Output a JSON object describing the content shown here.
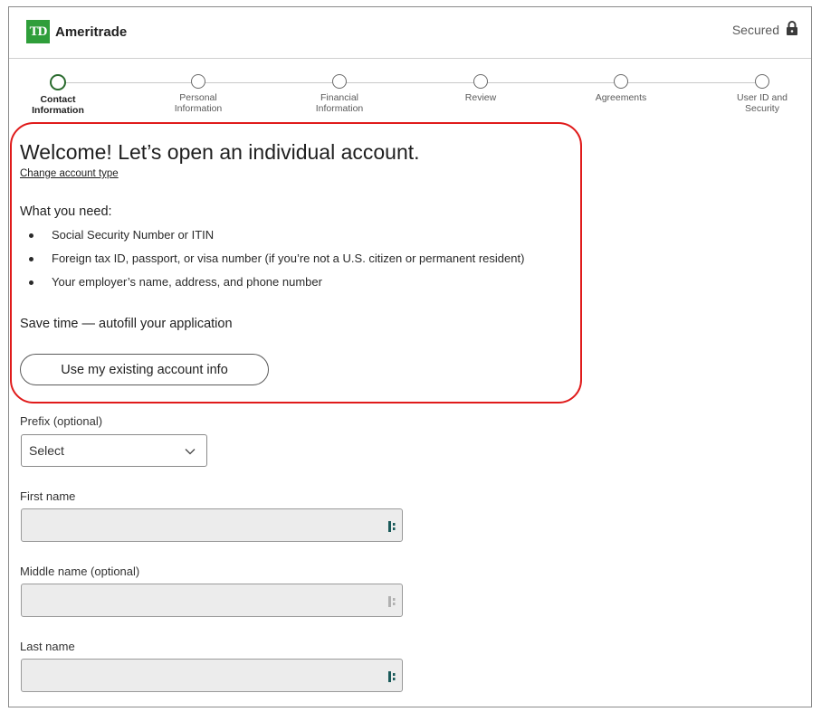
{
  "header": {
    "brand_mark": "TD",
    "brand_name": "Ameritrade",
    "secured_label": "Secured"
  },
  "steps": [
    {
      "label_line1": "Contact",
      "label_line2": "Information",
      "active": true
    },
    {
      "label_line1": "Personal",
      "label_line2": "Information",
      "active": false
    },
    {
      "label_line1": "Financial",
      "label_line2": "Information",
      "active": false
    },
    {
      "label_line1": "Review",
      "label_line2": "",
      "active": false
    },
    {
      "label_line1": "Agreements",
      "label_line2": "",
      "active": false
    },
    {
      "label_line1": "User ID and",
      "label_line2": "Security",
      "active": false
    }
  ],
  "intro": {
    "title": "Welcome! Let’s open an individual account.",
    "change_link": "Change account type",
    "need_heading": "What you need:",
    "needs": [
      "Social Security Number or ITIN",
      "Foreign tax ID, passport, or visa number (if you’re not a U.S. citizen or permanent resident)",
      "Your employer’s name, address, and phone number"
    ],
    "autofill_heading": "Save time — autofill your application",
    "autofill_button": "Use my existing account info"
  },
  "form": {
    "prefix_label": "Prefix (optional)",
    "prefix_value": "Select",
    "first_name_label": "First name",
    "first_name_value": "",
    "middle_name_label": "Middle name (optional)",
    "middle_name_value": "",
    "last_name_label": "Last name",
    "last_name_value": ""
  },
  "colors": {
    "brand_green": "#2f9e3a",
    "highlight_red": "#e01b1b",
    "input_bg": "#ececec",
    "active_step": "#2a6b2e",
    "autofill_icon": "#1a5a5a"
  }
}
